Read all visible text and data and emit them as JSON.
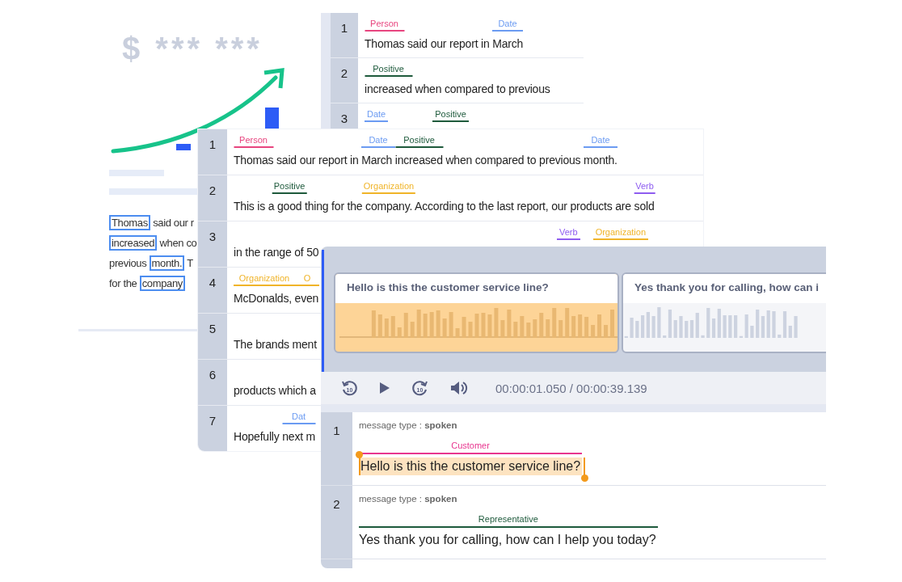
{
  "doc_card": {
    "amount": "$ *** ***",
    "lines": [
      {
        "segments": [
          {
            "text": "Thomas",
            "boxed": true
          },
          {
            "text": " said our r",
            "boxed": false
          }
        ]
      },
      {
        "segments": [
          {
            "text": "increased",
            "boxed": true
          },
          {
            "text": " when co",
            "boxed": false
          }
        ]
      },
      {
        "segments": [
          {
            "text": "previous ",
            "boxed": false
          },
          {
            "text": "month.",
            "boxed": true
          },
          {
            "text": " T",
            "boxed": false
          }
        ]
      },
      {
        "segments": [
          {
            "text": "for the ",
            "boxed": false
          },
          {
            "text": "company",
            "boxed": true
          }
        ]
      }
    ]
  },
  "back_panel": {
    "rows": [
      {
        "number": "1",
        "segments": [
          {
            "text": "Thomas",
            "tag": {
              "label": "Person",
              "color": "#e8457f"
            }
          },
          {
            "text": " said our report in "
          },
          {
            "text": "March",
            "tag": {
              "label": "Date",
              "color": "#6b9bf2"
            }
          }
        ]
      },
      {
        "number": "2",
        "segments": [
          {
            "text": "increased",
            "tag": {
              "label": "Positive",
              "color": "#1e5a3c"
            }
          },
          {
            "text": " when compared to previous"
          }
        ]
      },
      {
        "number": "3",
        "tags": [
          {
            "label": "Date",
            "color": "#6b9bf2"
          },
          {
            "label": "Positive",
            "color": "#1e5a3c"
          }
        ]
      }
    ]
  },
  "main_panel": {
    "rows": [
      {
        "number": "1",
        "segments": [
          {
            "text": "Thomas",
            "tag": {
              "label": "Person",
              "color": "#e8457f"
            }
          },
          {
            "text": " said our report in "
          },
          {
            "text": "March ",
            "tag": {
              "label": "Date",
              "color": "#6b9bf2"
            }
          },
          {
            "text": "increased",
            "tag": {
              "label": "Positive",
              "color": "#1e5a3c"
            }
          },
          {
            "text": " when compared to previous "
          },
          {
            "text": "month.",
            "tag": {
              "label": "Date",
              "color": "#6b9bf2"
            }
          }
        ]
      },
      {
        "number": "2",
        "segments": [
          {
            "text": "This is a "
          },
          {
            "text": "good",
            "tag": {
              "label": "Positive",
              "color": "#1e5a3c"
            }
          },
          {
            "text": " thing for the "
          },
          {
            "text": "company.",
            "tag": {
              "label": "Organization",
              "color": "#f0b429"
            }
          },
          {
            "text": " According to the last report, our products are "
          },
          {
            "text": "sold",
            "tag": {
              "label": "Verb",
              "color": "#8e5cf0"
            }
          }
        ]
      },
      {
        "number": "3",
        "segments": [
          {
            "text": "in the range of 50"
          }
        ],
        "tags": [
          {
            "label": "Verb",
            "color": "#8e5cf0"
          },
          {
            "label": "Organization",
            "color": "#f0b429"
          }
        ]
      },
      {
        "number": "4",
        "segments": [
          {
            "text": "McDonalds, ",
            "tag": {
              "label": "Organization",
              "color": "#f0b429"
            }
          },
          {
            "text": "even",
            "tag": {
              "label": "O",
              "color": "#f0b429"
            }
          }
        ]
      },
      {
        "number": "5",
        "segments": [
          {
            "text": "The brands ment"
          }
        ]
      },
      {
        "number": "6",
        "segments": [
          {
            "text": "products which a"
          }
        ]
      },
      {
        "number": "7",
        "segments": [
          {
            "text": "Hopefully "
          },
          {
            "text": "next m",
            "tag": {
              "label": "Dat",
              "color": "#6b9bf2"
            }
          }
        ]
      }
    ]
  },
  "audio_panel": {
    "cards": [
      {
        "title": "Hello is this the customer service line?",
        "selected": true
      },
      {
        "title": "Yes thank you for calling, how can i",
        "selected": false
      }
    ],
    "controls": [
      {
        "kind": "rewind",
        "label": "10"
      },
      {
        "kind": "play"
      },
      {
        "kind": "forward",
        "label": "10"
      },
      {
        "kind": "volume"
      }
    ],
    "time": "00:00:01.050 / 00:00:39.139",
    "messages": [
      {
        "number": "1",
        "meta": "message type : **spoken**",
        "speaker": {
          "label": "Customer",
          "color": "#e8368f"
        },
        "text": "Hello is this the customer service line?",
        "selected": true
      },
      {
        "number": "2",
        "meta": "message type : **spoken**",
        "speaker": {
          "label": "Representative",
          "color": "#1e5a3c"
        },
        "text": "Yes thank you for calling, how can I help you today?",
        "selected": false
      }
    ]
  }
}
